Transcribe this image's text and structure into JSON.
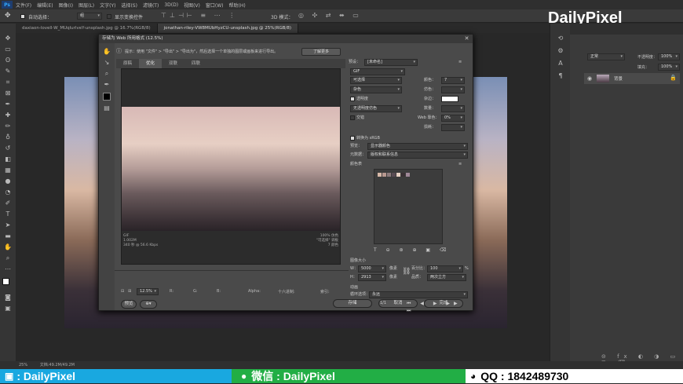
{
  "menu": [
    "文件(F)",
    "编辑(E)",
    "图像(I)",
    "图层(L)",
    "文字(Y)",
    "选择(S)",
    "滤镜(T)",
    "3D(D)",
    "视图(V)",
    "窗口(W)",
    "帮助(H)"
  ],
  "options": {
    "auto_select": "自动选择：",
    "layer": "组",
    "show_transform": "显示变换控件",
    "mode_3d": "3D 模式："
  },
  "doc_tabs": [
    "daxiaon-lovell-W_MUqlurlveY-unsplash.jpg @ 16.7%(RGB/8)",
    "jonathan-riley-VW8MUbHyzCU-unsplash.jpg @ 25%(RGB/8)"
  ],
  "status": {
    "zoom": "25%",
    "doc": "文档:49.2M/49.2M"
  },
  "watermark": "DailyPixel",
  "footer": {
    "bili": ": DailyPixel",
    "wechat": "微信 : DailyPixel",
    "qq": "QQ : 1842489730"
  },
  "dialog": {
    "title": "存储为 Web 所用格式 (12.5%)",
    "hint": "提示：使用 \"文件\" > \"导出\" > \"导出为\"，然后选择一个单独的图层或画板来进行导出。",
    "more_button": "了解更多",
    "tabs": [
      "原稿",
      "优化",
      "双联",
      "四联"
    ],
    "preview_info_left": [
      "GIF",
      "1.002M",
      "340 秒 @ 56.6 Kbps"
    ],
    "preview_info_right": [
      "100% 仿色",
      "\"可选择\" 调板",
      "7 颜色"
    ],
    "bottom": {
      "zoom": "12.5%",
      "r": "R:",
      "g": "G:",
      "b": "B:",
      "alpha": "Alpha:",
      "hex": "十六进制:",
      "index": "索引:"
    },
    "buttons": {
      "preview": "预览",
      "save": "存储",
      "cancel": "取消",
      "done": "完成"
    },
    "right": {
      "preset_label": "预设：",
      "preset_value": "[未命名]",
      "format": "GIF",
      "reduction": "可选择",
      "colors_label": "颜色：",
      "colors_value": "7",
      "dither_algo": "杂色",
      "dither_label": "仿色：",
      "transparency": "透明度",
      "matte_label": "杂边：",
      "trans_dither": "无透明度仿色",
      "amount_label": "数量：",
      "interlaced": "交错",
      "websnap_label": "Web 靠色：",
      "websnap_value": "0%",
      "lossy_label": "损耗：",
      "convert_srgb": "转换为 sRGB",
      "preview_label": "预览：",
      "preview_value": "显示器颜色",
      "metadata_label": "元数据：",
      "metadata_value": "版权和联系信息",
      "colortable_label": "颜色表",
      "imagesize_label": "图像大小",
      "w_label": "W：",
      "w_value": "5000",
      "h_label": "H：",
      "h_value": "2913",
      "unit": "像素",
      "percent_label": "百分比：",
      "percent_value": "100",
      "percent_unit": "%",
      "quality_label": "品质：",
      "quality_value": "两次立方",
      "anim_label": "动画",
      "loop_label": "循环选项：",
      "loop_value": "永远",
      "frame_counter": "1/1"
    }
  },
  "layers": {
    "blend": "正常",
    "opacity_label": "不透明度：",
    "opacity": "100%",
    "fill_label": "填充：",
    "fill": "100%",
    "layer_name": "背景"
  },
  "swatch_colors": [
    "#d7b8a8",
    "#b89890",
    "#8c7a7c",
    "#5a4c54",
    "#e8d2c4",
    "#3a3034",
    "#a08898"
  ]
}
